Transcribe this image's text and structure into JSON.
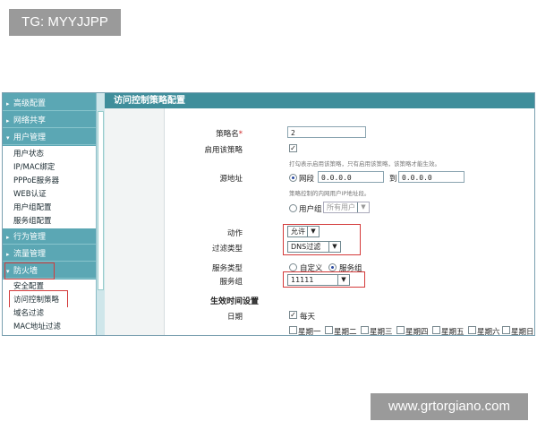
{
  "watermarks": {
    "top": "TG: MYYJJPP",
    "bottom": "www.grtorgiano.com"
  },
  "sidebar": {
    "menus": [
      {
        "label": "高级配置"
      },
      {
        "label": "网络共享"
      },
      {
        "label": "用户管理"
      },
      {
        "label": "行为管理"
      },
      {
        "label": "流量管理"
      },
      {
        "label": "防火墙"
      }
    ],
    "user_items": [
      "用户状态",
      "IP/MAC绑定",
      "PPPoE服务器",
      "WEB认证",
      "用户组配置",
      "服务组配置"
    ],
    "firewall_items": [
      "安全配置",
      "访问控制策略",
      "域名过滤",
      "MAC地址过滤"
    ]
  },
  "page": {
    "title": "访问控制策略配置"
  },
  "form": {
    "name_label": "策略名",
    "required_mark": "*",
    "name_value": "2",
    "enable_label": "启用该策略",
    "enable_checked": true,
    "enable_hint": "打勾表示启用该策略，只有启用该策略，该策略才能生效。",
    "src_label": "源地址",
    "range_label": "网段",
    "range_start": "0.0.0.0",
    "to_label": "到",
    "range_end": "0.0.0.0",
    "src_hint": "策略控制的内网用户IP地址段。",
    "group_label": "用户组",
    "group_value": "所有用户",
    "action_label": "动作",
    "action_value": "允许",
    "filter_label": "过滤类型",
    "filter_value": "DNS过滤",
    "svc_type_label": "服务类型",
    "svc_custom": "自定义",
    "svc_group": "服务组",
    "svc_group_label": "服务组",
    "svc_group_value": "11111",
    "time_section": "生效时间设置",
    "date_label": "日期",
    "everyday": "每天",
    "days": [
      "星期一",
      "星期二",
      "星期三",
      "星期四",
      "星期五",
      "星期六",
      "星期日"
    ]
  }
}
